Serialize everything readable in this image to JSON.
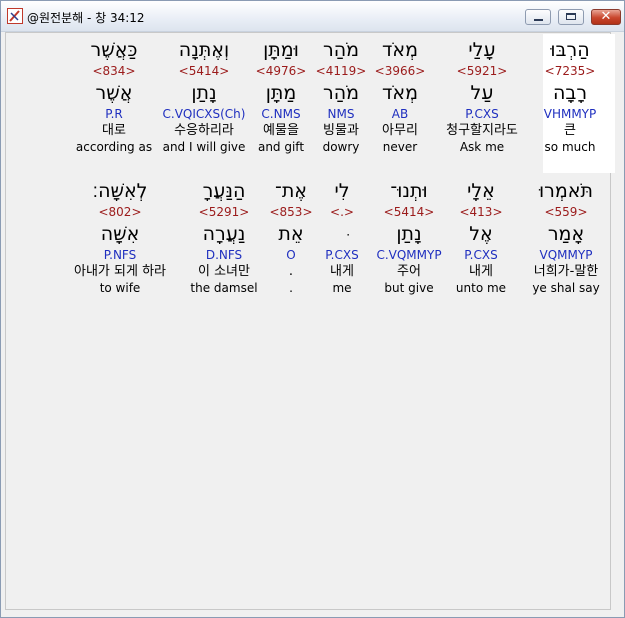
{
  "window": {
    "title": "@원전분해 - 창 34:12",
    "buttons": {
      "minimize": "minimize",
      "maximize": "maximize",
      "close": "close"
    },
    "close_glyph": "✕"
  },
  "rows": [
    {
      "words": [
        {
          "heb": "הַרְבּוּ",
          "num": "<7235>",
          "lex": "רָבָה",
          "parse": "VHMMYP",
          "ko": "큰",
          "en": "so much",
          "selected": true
        },
        {
          "heb": "עָלַי",
          "num": "<5921>",
          "lex": "עַל",
          "parse": "P.CXS",
          "ko": "청구할지라도",
          "en": "Ask me"
        },
        {
          "heb": "מְאֹד",
          "num": "<3966>",
          "lex": "מְאֹד",
          "parse": "AB",
          "ko": "아무리",
          "en": "never"
        },
        {
          "heb": "מֹהַר",
          "num": "<4119>",
          "lex": "מֹהַר",
          "parse": "NMS",
          "ko": "빙물과",
          "en": "dowry"
        },
        {
          "heb": "וּמַתָּן",
          "num": "<4976>",
          "lex": "מַתָּן",
          "parse": "C.NMS",
          "ko": "예물을",
          "en": "and gift"
        },
        {
          "heb": "וְאֶתְּנָה",
          "num": "<5414>",
          "lex": "נָתַן",
          "parse": "C.VQICXS(Ch)",
          "ko": "수응하리라",
          "en": "and I will give"
        },
        {
          "heb": "כַּאֲשֶׁר",
          "num": "<834>",
          "lex": "אֲשֶׁר",
          "parse": "P.R",
          "ko": "대로",
          "en": "according as"
        }
      ]
    },
    {
      "words": [
        {
          "heb": "תֹּאמְרוּ",
          "num": "<559>",
          "lex": "אָמַר",
          "parse": "VQMMYP",
          "ko": "너희가-말한",
          "en": "ye shal say"
        },
        {
          "heb": "אֵלָי",
          "num": "<413>",
          "lex": "אֶל",
          "parse": "P.CXS",
          "ko": "내게",
          "en": "unto me"
        },
        {
          "heb": "וּתְנוּ־",
          "num": "<5414>",
          "lex": "נָתַן",
          "parse": "C.VQMMYP",
          "ko": "주어",
          "en": "but give"
        },
        {
          "heb": "לִי",
          "num": "<.>",
          "lex": "ּ",
          "parse": "P.CXS",
          "ko": "내게",
          "en": "me"
        },
        {
          "heb": "אֶת־",
          "num": "<853>",
          "lex": "אֵת",
          "parse": "O",
          "ko": ".",
          "en": "."
        },
        {
          "heb": "הַנַּעֲרָ",
          "num": "<5291>",
          "lex": "נַעֲרָה",
          "parse": "D.NFS",
          "ko": "이 소녀만",
          "en": "the damsel"
        },
        {
          "heb": "לְאִשָּׁה׃",
          "num": "<802>",
          "lex": "אִשָּׁה",
          "parse": "P.NFS",
          "ko": "아내가 되게 하라",
          "en": "to wife"
        }
      ]
    }
  ]
}
